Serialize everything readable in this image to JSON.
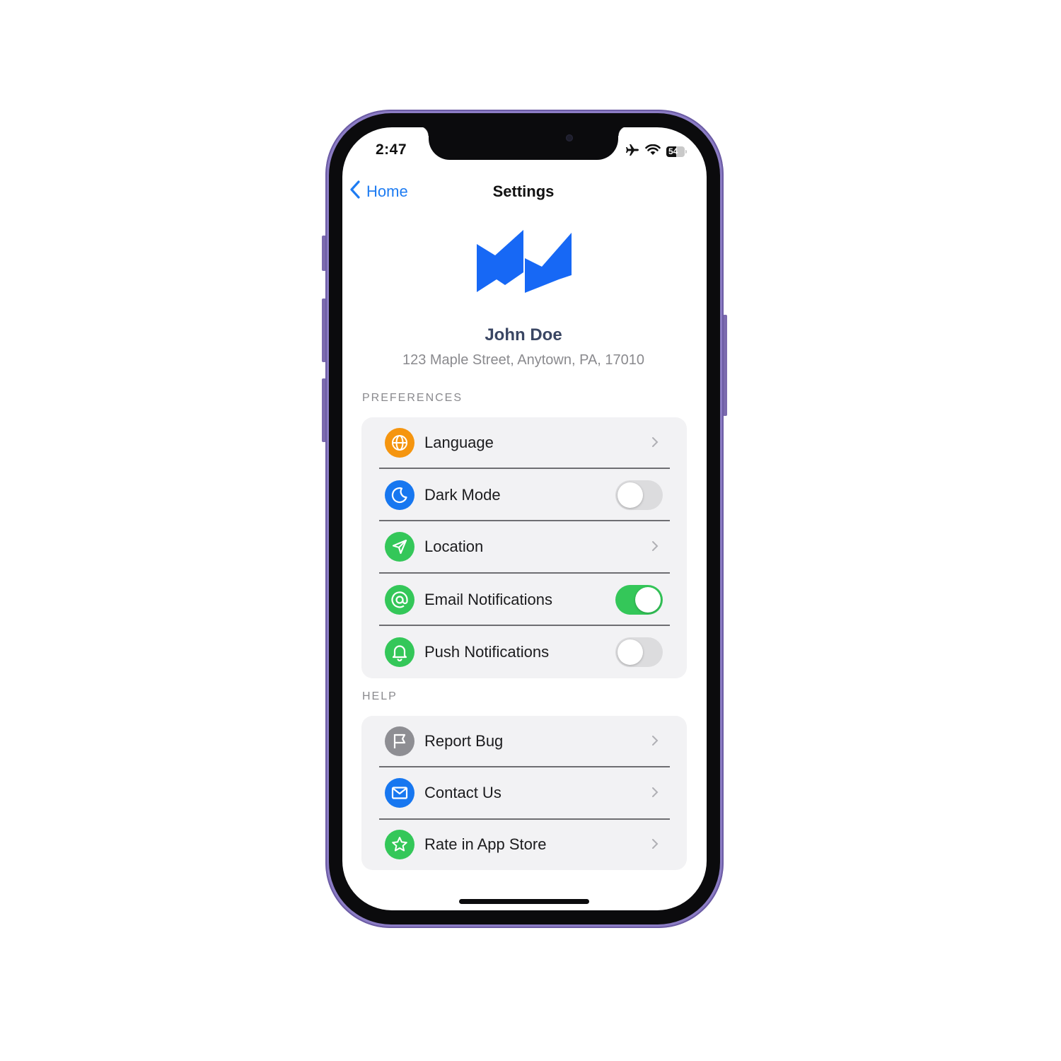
{
  "status_bar": {
    "time": "2:47",
    "battery_level": "54",
    "icons": [
      "airplane-icon",
      "wifi-icon",
      "battery-icon"
    ]
  },
  "nav": {
    "back_label": "Home",
    "title": "Settings"
  },
  "profile": {
    "name": "John Doe",
    "address": "123 Maple Street, Anytown, PA, 17010"
  },
  "colors": {
    "accent": "#1e7cf2",
    "logo": "#1768f5",
    "toggle_on": "#34c759",
    "toggle_off": "#dcdcde",
    "frame": "#8b7cc4"
  },
  "preferences": {
    "header": "PREFERENCES",
    "items": [
      {
        "label": "Language",
        "icon": "globe-icon",
        "icon_color": "#f5950f",
        "control": "chevron"
      },
      {
        "label": "Dark Mode",
        "icon": "moon-icon",
        "icon_color": "#1777f0",
        "control": "toggle",
        "on": false
      },
      {
        "label": "Location",
        "icon": "location-arrow-icon",
        "icon_color": "#34c759",
        "control": "chevron"
      },
      {
        "label": "Email Notifications",
        "icon": "at-icon",
        "icon_color": "#34c759",
        "control": "toggle",
        "on": true
      },
      {
        "label": "Push Notifications",
        "icon": "bell-icon",
        "icon_color": "#34c759",
        "control": "toggle",
        "on": false
      }
    ]
  },
  "help": {
    "header": "HELP",
    "items": [
      {
        "label": "Report Bug",
        "icon": "flag-icon",
        "icon_color": "#8e8e93",
        "control": "chevron"
      },
      {
        "label": "Contact Us",
        "icon": "envelope-icon",
        "icon_color": "#1777f0",
        "control": "chevron"
      },
      {
        "label": "Rate in App Store",
        "icon": "star-icon",
        "icon_color": "#34c759",
        "control": "chevron"
      }
    ]
  }
}
